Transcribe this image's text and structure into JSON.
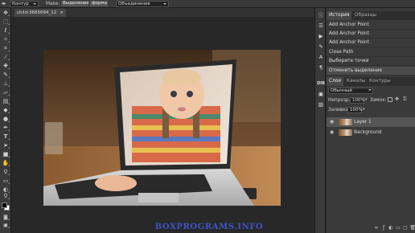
{
  "options_bar": {
    "tool_mode": "Контур",
    "make_label": "Make:",
    "make_selection_btn": "Выделение",
    "make_shape_btn": "форма",
    "combine_mode": "Объединение"
  },
  "document": {
    "tab_title": "child-3665694_12",
    "close_symbol": "×"
  },
  "history_panel": {
    "tabs": [
      "История",
      "Образцы"
    ],
    "items": [
      "Add Anchor Point",
      "Add Anchor Point",
      "Add Anchor Point",
      "Close Path",
      "Выберите точки",
      "Отменить выделение"
    ]
  },
  "layers_panel": {
    "tabs": [
      "Слои",
      "Каналы",
      "Контуры"
    ],
    "blend_mode": "Обычный",
    "opacity_label": "Непрозр.",
    "opacity_value": "100%",
    "lock_label": "Замок:",
    "fill_label": "Заливка:",
    "fill_value": "100%",
    "layers": [
      {
        "name": "Layer 1",
        "visible": true,
        "selected": true
      },
      {
        "name": "Background",
        "visible": true,
        "selected": false
      }
    ]
  },
  "right_strip": {
    "dim_label": "DIB"
  },
  "watermark": "BOXPROGRAMS.INFO",
  "colors": {
    "foreground": "#000000",
    "background": "#ffffff",
    "watermark": "#3c53c8",
    "panel": "#3a3a3a",
    "canvas_bg": "#282828"
  },
  "icons": {
    "toolbar": [
      "move-icon",
      "marquee-icon",
      "lasso-icon",
      "magic-wand-icon",
      "crop-icon",
      "eyedropper-icon",
      "healing-icon",
      "brush-icon",
      "clone-stamp-icon",
      "eraser-icon",
      "gradient-icon",
      "blur-icon",
      "dodge-icon",
      "pen-icon",
      "type-icon",
      "path-select-icon",
      "shape-icon",
      "hand-icon",
      "zoom-icon"
    ],
    "right_strip": [
      "info-icon",
      "sliders-icon",
      "play-icon",
      "brush-settings-icon",
      "character-icon",
      "paragraph-icon",
      "dib-icon",
      "css-icon",
      "image-icon"
    ]
  }
}
